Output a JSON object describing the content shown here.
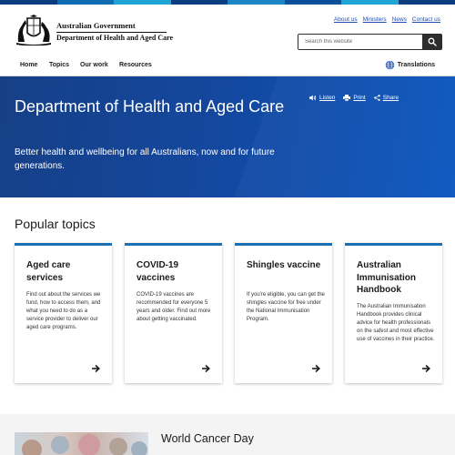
{
  "colors": {
    "hero_bg": "#14479d",
    "link": "#1f4fb0",
    "card_accent": "#1f6fb3",
    "top_strip": [
      "#0b3d7e",
      "#0e6db3",
      "#1fa5d4",
      "#0b3d7e",
      "#1c85c6",
      "#0a4f9a",
      "#21a7d6",
      "#0b3d7e"
    ]
  },
  "header": {
    "government": "Australian Government",
    "department": "Department of Health and Aged Care",
    "crest_icon": "coat-of-arms-icon",
    "utility_links": [
      "About us",
      "Ministers",
      "News",
      "Contact us"
    ],
    "search": {
      "placeholder": "Search this website",
      "value": "",
      "icon": "search-icon"
    }
  },
  "nav": {
    "items": [
      "Home",
      "Topics",
      "Our work",
      "Resources"
    ],
    "translations": "Translations",
    "translations_icon": "globe-icon"
  },
  "hero": {
    "title": "Department of Health and Aged Care",
    "subtitle": "Better health and wellbeing for all Australians, now and for future generations.",
    "actions": [
      {
        "label": "Listen",
        "icon": "speaker-icon"
      },
      {
        "label": "Print",
        "icon": "printer-icon"
      },
      {
        "label": "Share",
        "icon": "share-icon"
      }
    ]
  },
  "popular": {
    "heading": "Popular topics",
    "cards": [
      {
        "title": "Aged care services",
        "description": "Find out about the services we fund, how to access them, and what you need to do as a service provider to deliver our aged care programs."
      },
      {
        "title": "COVID-19 vaccines",
        "description": "COVID-19 vaccines are recommended for everyone 5 years and older. Find out more about getting vaccinated."
      },
      {
        "title": "Shingles vaccine",
        "description": "If you're eligible, you can get the shingles vaccine for free under the National Immunisation Program."
      },
      {
        "title": "Australian Immunisation Handbook",
        "description": "The Australian Immunisation Handbook provides clinical advice for health professionals on the safest and most effective use of vaccines in their practice."
      }
    ]
  },
  "feature": {
    "title": "World Cancer Day"
  }
}
